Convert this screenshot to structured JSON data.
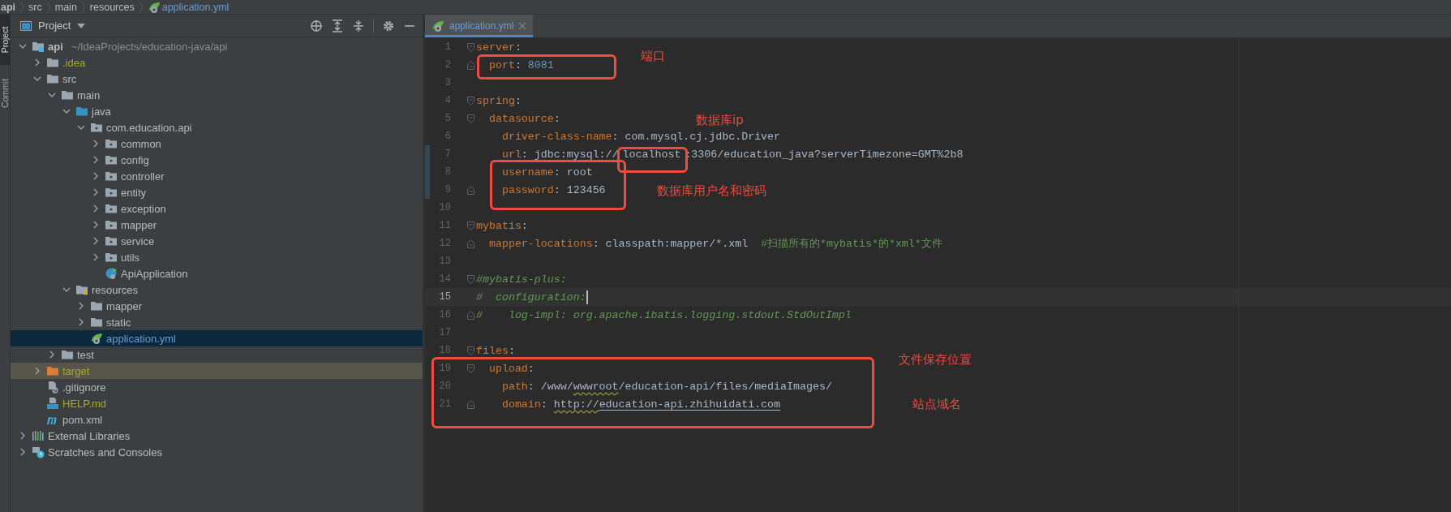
{
  "breadcrumb": [
    {
      "label": "api",
      "kind": "module"
    },
    {
      "label": "src",
      "kind": "folder"
    },
    {
      "label": "main",
      "kind": "folder"
    },
    {
      "label": "resources",
      "kind": "folder"
    },
    {
      "label": "application.yml",
      "kind": "spring"
    }
  ],
  "tool_strip": [
    {
      "label": "Project",
      "selected": true
    },
    {
      "label": "Commit",
      "selected": false
    }
  ],
  "project_panel": {
    "title": "Project",
    "tree": [
      {
        "label": "api",
        "kind": "module",
        "path": "~/IdeaProjects/education-java/api",
        "expanded": true,
        "selected": false,
        "children": [
          {
            "label": ".idea",
            "kind": "folder",
            "ignored": true,
            "expanded": false,
            "selected": false
          },
          {
            "label": "src",
            "kind": "folder",
            "expanded": true,
            "selected": false,
            "children": [
              {
                "label": "main",
                "kind": "folder",
                "expanded": true,
                "selected": false,
                "children": [
                  {
                    "label": "java",
                    "kind": "source",
                    "expanded": true,
                    "selected": false,
                    "children": [
                      {
                        "label": "com.education.api",
                        "kind": "package",
                        "expanded": true,
                        "selected": false,
                        "children": [
                          {
                            "label": "common",
                            "kind": "package",
                            "expanded": false,
                            "selected": false
                          },
                          {
                            "label": "config",
                            "kind": "package",
                            "expanded": false,
                            "selected": false
                          },
                          {
                            "label": "controller",
                            "kind": "package",
                            "expanded": false,
                            "selected": false
                          },
                          {
                            "label": "entity",
                            "kind": "package",
                            "expanded": false,
                            "selected": false
                          },
                          {
                            "label": "exception",
                            "kind": "package",
                            "expanded": false,
                            "selected": false
                          },
                          {
                            "label": "mapper",
                            "kind": "package",
                            "expanded": false,
                            "selected": false
                          },
                          {
                            "label": "service",
                            "kind": "package",
                            "expanded": false,
                            "selected": false
                          },
                          {
                            "label": "utils",
                            "kind": "package",
                            "expanded": false,
                            "selected": false
                          },
                          {
                            "label": "ApiApplication",
                            "kind": "app",
                            "selected": false
                          }
                        ]
                      }
                    ]
                  },
                  {
                    "label": "resources",
                    "kind": "resources",
                    "expanded": true,
                    "selected": false,
                    "children": [
                      {
                        "label": "mapper",
                        "kind": "folder",
                        "expanded": false,
                        "selected": false
                      },
                      {
                        "label": "static",
                        "kind": "folder",
                        "expanded": false,
                        "selected": false
                      },
                      {
                        "label": "application.yml",
                        "kind": "spring",
                        "selected": true
                      }
                    ]
                  }
                ]
              },
              {
                "label": "test",
                "kind": "folder",
                "expanded": false,
                "selected": false
              }
            ]
          },
          {
            "label": "target",
            "kind": "excluded",
            "ignored": true,
            "expanded": false,
            "selected": false
          },
          {
            "label": ".gitignore",
            "kind": "gitignore",
            "selected": false
          },
          {
            "label": "HELP.md",
            "kind": "markdown",
            "ignored": true,
            "selected": false
          },
          {
            "label": "pom.xml",
            "kind": "maven",
            "selected": false
          }
        ]
      },
      {
        "label": "External Libraries",
        "kind": "libraries",
        "expanded": false,
        "selected": false
      },
      {
        "label": "Scratches and Consoles",
        "kind": "scratches",
        "expanded": false,
        "selected": false
      }
    ]
  },
  "editor": {
    "tabs": [
      {
        "label": "application.yml",
        "selected": true
      }
    ],
    "lines": [
      {
        "number": "1",
        "fold_start": true,
        "segments": [
          {
            "text": "server",
            "kind": "key"
          },
          {
            "text": ":",
            "kind": "plain"
          }
        ]
      },
      {
        "number": "2",
        "fold_end": true,
        "segments": [
          {
            "text": "  port",
            "kind": "key"
          },
          {
            "text": ": ",
            "kind": "plain"
          },
          {
            "text": "8081",
            "kind": "number"
          }
        ]
      },
      {
        "number": "3"
      },
      {
        "number": "4",
        "fold_start": true,
        "segments": [
          {
            "text": "spring",
            "kind": "key"
          },
          {
            "text": ":",
            "kind": "plain"
          }
        ]
      },
      {
        "number": "5",
        "fold_start": true,
        "segments": [
          {
            "text": "  datasource",
            "kind": "key"
          },
          {
            "text": ":",
            "kind": "plain"
          }
        ]
      },
      {
        "number": "6",
        "segments": [
          {
            "text": "    driver-class-name",
            "kind": "key"
          },
          {
            "text": ": com.mysql.cj.jdbc.Driver",
            "kind": "plain"
          }
        ]
      },
      {
        "number": "7",
        "changed": true,
        "segments": [
          {
            "text": "    url",
            "kind": "key"
          },
          {
            "text": ": jdbc:mysql://",
            "kind": "plain"
          },
          {
            "text": "localhost",
            "kind": "gap"
          },
          {
            "text": ":3306/education_java?serverTimezone=GMT%2b8",
            "kind": "plain"
          }
        ]
      },
      {
        "number": "8",
        "changed": true,
        "segments": [
          {
            "text": "    username",
            "kind": "key"
          },
          {
            "text": ": root",
            "kind": "plain"
          }
        ]
      },
      {
        "number": "9",
        "changed": true,
        "fold_end": true,
        "segments": [
          {
            "text": "    password",
            "kind": "key"
          },
          {
            "text": ": 123456",
            "kind": "plain"
          }
        ]
      },
      {
        "number": "10"
      },
      {
        "number": "11",
        "fold_start": true,
        "segments": [
          {
            "text": "mybatis",
            "kind": "key"
          },
          {
            "text": ":",
            "kind": "plain"
          }
        ]
      },
      {
        "number": "12",
        "fold_end": true,
        "segments": [
          {
            "text": "  mapper-locations",
            "kind": "key"
          },
          {
            "text": ": classpath:mapper/*.xml  ",
            "kind": "plain"
          },
          {
            "text": "#扫描所有的*mybatis*的*xml*文件",
            "kind": "note"
          }
        ]
      },
      {
        "number": "13"
      },
      {
        "number": "14",
        "fold_start": true,
        "segments": [
          {
            "text": "#mybatis-plus:",
            "kind": "comment"
          }
        ]
      },
      {
        "number": "15",
        "current": true,
        "segments": [
          {
            "text": "#  configuration:",
            "kind": "comment"
          }
        ]
      },
      {
        "number": "16",
        "fold_end": true,
        "segments": [
          {
            "text": "#    log-impl: org.apache.ibatis.logging.stdout.StdOutImpl",
            "kind": "comment"
          }
        ]
      },
      {
        "number": "17"
      },
      {
        "number": "18",
        "fold_start": true,
        "segments": [
          {
            "text": "files",
            "kind": "key"
          },
          {
            "text": ":",
            "kind": "plain"
          }
        ]
      },
      {
        "number": "19",
        "fold_start": true,
        "segments": [
          {
            "text": "  upload",
            "kind": "key"
          },
          {
            "text": ":",
            "kind": "plain"
          }
        ]
      },
      {
        "number": "20",
        "segments": [
          {
            "text": "    path",
            "kind": "key"
          },
          {
            "text": ": /www/",
            "kind": "plain"
          },
          {
            "text": "wwwroot",
            "kind": "typo"
          },
          {
            "text": "/education-api/files/mediaImages/",
            "kind": "plain"
          }
        ]
      },
      {
        "number": "21",
        "fold_end": true,
        "segments": [
          {
            "text": "    domain",
            "kind": "key"
          },
          {
            "text": ": ",
            "kind": "plain"
          },
          {
            "text": "http://",
            "kind": "typo-link"
          },
          {
            "text": "education-api.zhihuidati.com",
            "kind": "link"
          }
        ]
      }
    ]
  },
  "annotations": [
    {
      "kind": "frame"
    },
    {
      "kind": "label",
      "text": "端口"
    },
    {
      "kind": "frame"
    },
    {
      "kind": "label",
      "text": "数据库ip"
    },
    {
      "kind": "frame"
    },
    {
      "kind": "label",
      "text": "数据库用户名和密码"
    },
    {
      "kind": "frame"
    },
    {
      "kind": "label",
      "text": "文件保存位置"
    },
    {
      "kind": "label",
      "text": "站点域名"
    }
  ]
}
